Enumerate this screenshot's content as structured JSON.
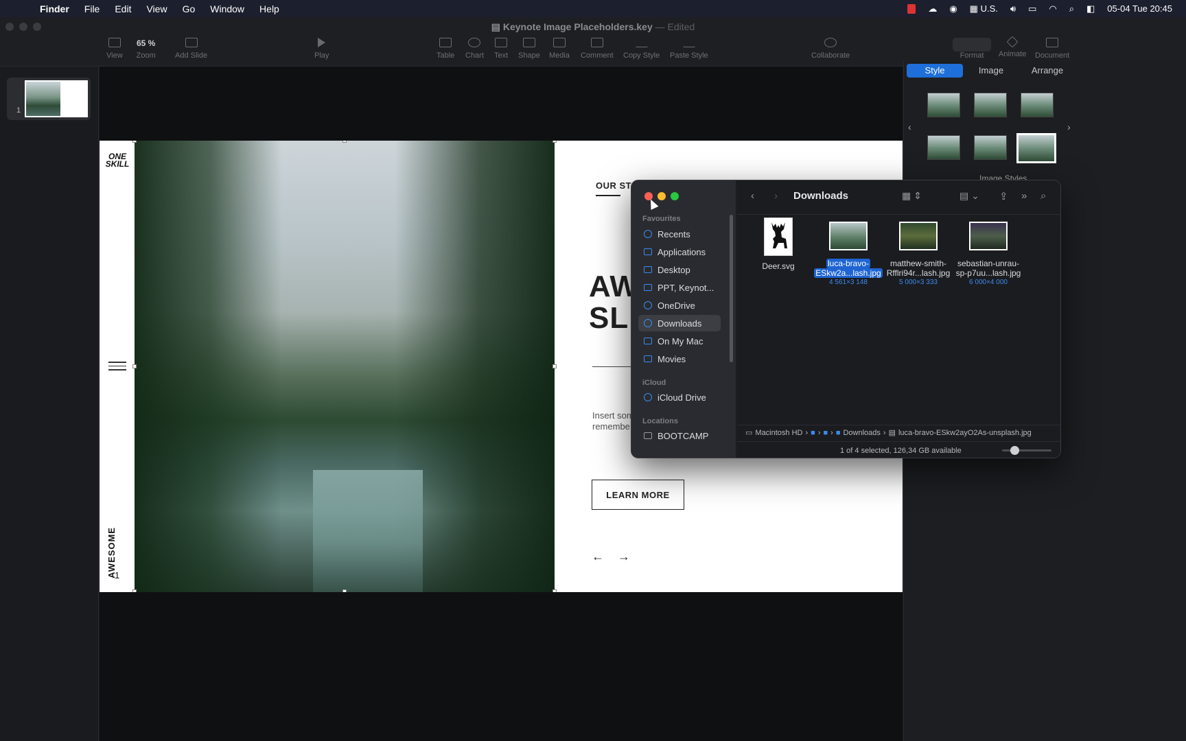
{
  "menubar": {
    "app": "Finder",
    "items": [
      "File",
      "Edit",
      "View",
      "Go",
      "Window",
      "Help"
    ],
    "input_source": "U.S.",
    "datetime": "05-04 Tue  20:45"
  },
  "keynote": {
    "doc_name": "Keynote Image Placeholders.key",
    "doc_status": "Edited",
    "toolbar": {
      "view": "View",
      "zoom_value": "65 %",
      "zoom": "Zoom",
      "add_slide": "Add Slide",
      "play": "Play",
      "table": "Table",
      "chart": "Chart",
      "text": "Text",
      "shape": "Shape",
      "media": "Media",
      "comment": "Comment",
      "copy_style": "Copy Style",
      "paste_style": "Paste Style",
      "collaborate": "Collaborate",
      "format": "Format",
      "animate": "Animate",
      "document": "Document"
    },
    "navigator": {
      "slide_number": "1"
    }
  },
  "slide": {
    "logo_line1": "ONE",
    "logo_line2": "SKILL",
    "vertical_text": "AWESOME",
    "page_number": "1",
    "our_story": "OUR STO",
    "headline_line1": "AW",
    "headline_line2": "SL",
    "body_line1": "Insert som",
    "body_line2": "remembe",
    "learn_more": "LEARN MORE",
    "arrow_left": "←",
    "arrow_right": "→"
  },
  "inspector": {
    "tabs": [
      "Style",
      "Image",
      "Arrange"
    ],
    "active_tab": "Style",
    "caption": "Image Styles"
  },
  "finder": {
    "title": "Downloads",
    "sidebar": {
      "favourites_header": "Favourites",
      "favourites": [
        "Recents",
        "Applications",
        "Desktop",
        "PPT, Keynot...",
        "OneDrive",
        "Downloads",
        "On My Mac",
        "Movies"
      ],
      "icloud_header": "iCloud",
      "icloud": [
        "iCloud Drive"
      ],
      "locations_header": "Locations",
      "locations": [
        "BOOTCAMP"
      ]
    },
    "files": [
      {
        "name_line1": "Deer.svg",
        "name_line2": "",
        "dims": ""
      },
      {
        "name_line1": "luca-bravo-",
        "name_line2": "ESkw2a...lash.jpg",
        "dims": "4 561×3 148"
      },
      {
        "name_line1": "matthew-smith-",
        "name_line2": "Rfflri94r...lash.jpg",
        "dims": "5 000×3 333"
      },
      {
        "name_line1": "sebastian-unrau-",
        "name_line2": "sp-p7uu...lash.jpg",
        "dims": "6 000×4 000"
      }
    ],
    "path": {
      "root": "Macintosh HD",
      "folder": "Downloads",
      "file": "luca-bravo-ESkw2ayO2As-unsplash.jpg"
    },
    "status": "1 of 4 selected, 126,34 GB available"
  },
  "colors": {
    "accent": "#1e6fd9",
    "close": "#ff5f57",
    "minimize": "#febc2e",
    "zoom": "#28c840"
  }
}
